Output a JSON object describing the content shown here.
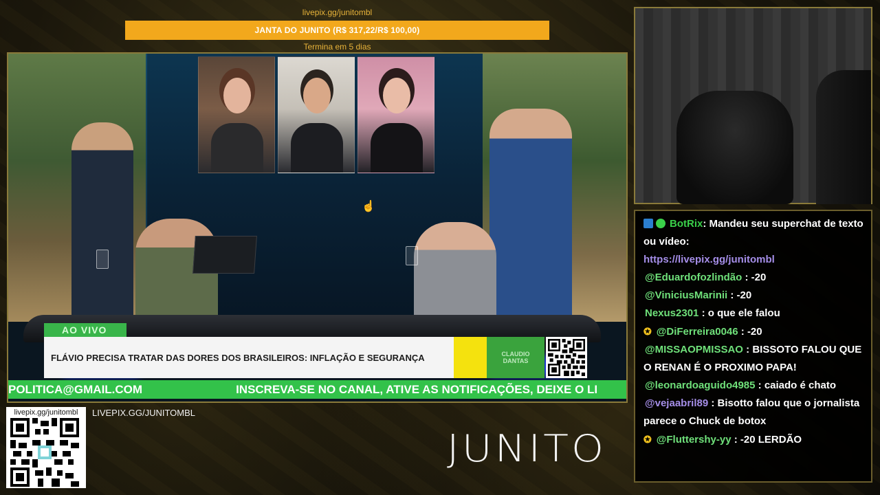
{
  "goal": {
    "url": "livepix.gg/junitombl",
    "label": "JANTA DO JUNITO (R$ 317,22/R$ 100,00)",
    "ends": "Termina em 5 dias",
    "progress_fraction": 1.0,
    "bar_color": "#f2a81c"
  },
  "broadcast": {
    "live_tag": "AO VIVO",
    "headline": "FLÁVIO PRECISA TRATAR DAS DORES DOS BRASILEIROS: INFLAÇÃO E SEGURANÇA",
    "logo_line1": "CLAUDIO",
    "logo_line2": "DANTAS",
    "ticker_left": "POLITICA@GMAIL.COM",
    "ticker_right": "INSCREVA-SE NO CANAL, ATIVE AS NOTIFICAÇÕES, DEIXE O LI",
    "ticker_color": "#33c24a"
  },
  "chat": {
    "messages": [
      {
        "user": "BotRix",
        "user_color": "#3ad14a",
        "text": ": Mandeu seu superchat de texto ou vídeo:",
        "link": "https://livepix.gg/junitombl",
        "badge": "bot"
      },
      {
        "user": "@Eduardofozlindão",
        "user_color": "#6fe07a",
        "text": " : -20",
        "badge": ""
      },
      {
        "user": "@ViniciusMarinii",
        "user_color": "#6fe07a",
        "text": " : -20",
        "badge": ""
      },
      {
        "user": "Nexus2301",
        "user_color": "#6fe07a",
        "text": " : o que ele falou",
        "badge": ""
      },
      {
        "user": "@DiFerreira0046",
        "user_color": "#6fe07a",
        "text": " : -20",
        "badge": "star"
      },
      {
        "user": "@MISSAOPMISSAO",
        "user_color": "#6fe07a",
        "text": " : BISSOTO FALOU QUE O RENAN É O PROXIMO PAPA!",
        "badge": ""
      },
      {
        "user": "@leonardoaguido4985",
        "user_color": "#6fe07a",
        "text": " : caiado é chato",
        "badge": ""
      },
      {
        "user": "@vejaabril89",
        "user_color": "#a58ee8",
        "text": " : Bisotto falou que o jornalista parece o Chuck de botox",
        "badge": ""
      },
      {
        "user": "@Fluttershy-yy",
        "user_color": "#6fe07a",
        "text": " : -20 LERDÃO",
        "badge": "star"
      }
    ]
  },
  "footer": {
    "qr_label": "livepix.gg/junitombl",
    "pix_link": "LIVEPIX.GG/JUNITOMBL",
    "brand": "JUNITO"
  }
}
